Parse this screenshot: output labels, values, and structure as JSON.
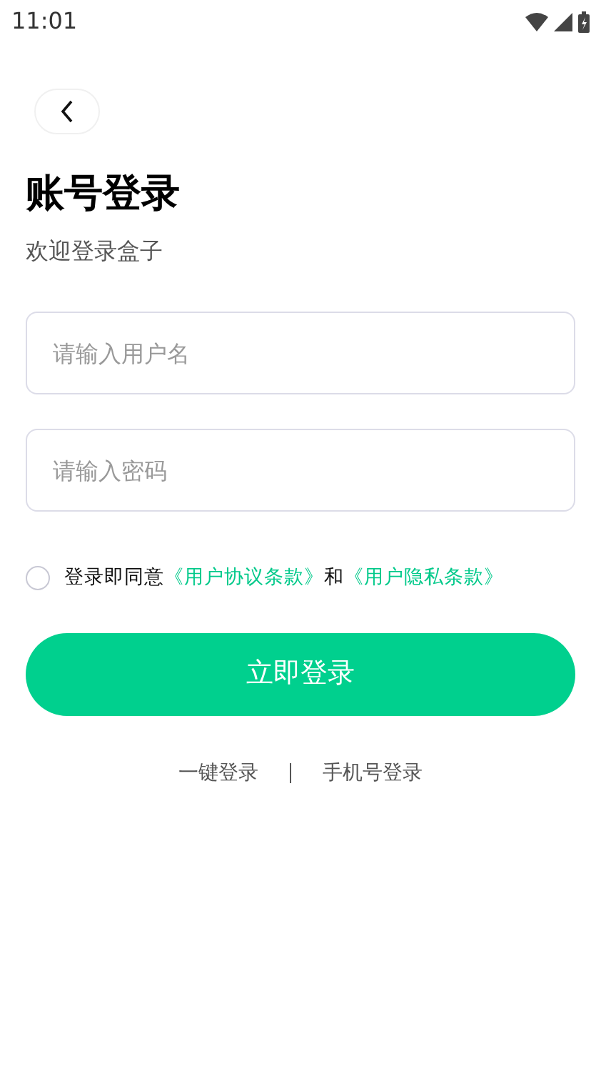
{
  "status_bar": {
    "time": "11:01"
  },
  "title": "账号登录",
  "subtitle": "欢迎登录盒子",
  "fields": [
    {
      "placeholder": "请输入用户名"
    },
    {
      "placeholder": "请输入密码"
    }
  ],
  "agreement": {
    "checked": false,
    "parts": [
      {
        "kind": "text",
        "text": "登录即同意"
      },
      {
        "kind": "link",
        "text": "《用户协议条款》"
      },
      {
        "kind": "text",
        "text": "和"
      },
      {
        "kind": "link",
        "text": "《用户隐私条款》"
      }
    ]
  },
  "login_button": "立即登录",
  "alt_logins": [
    "一键登录",
    "手机号登录"
  ]
}
